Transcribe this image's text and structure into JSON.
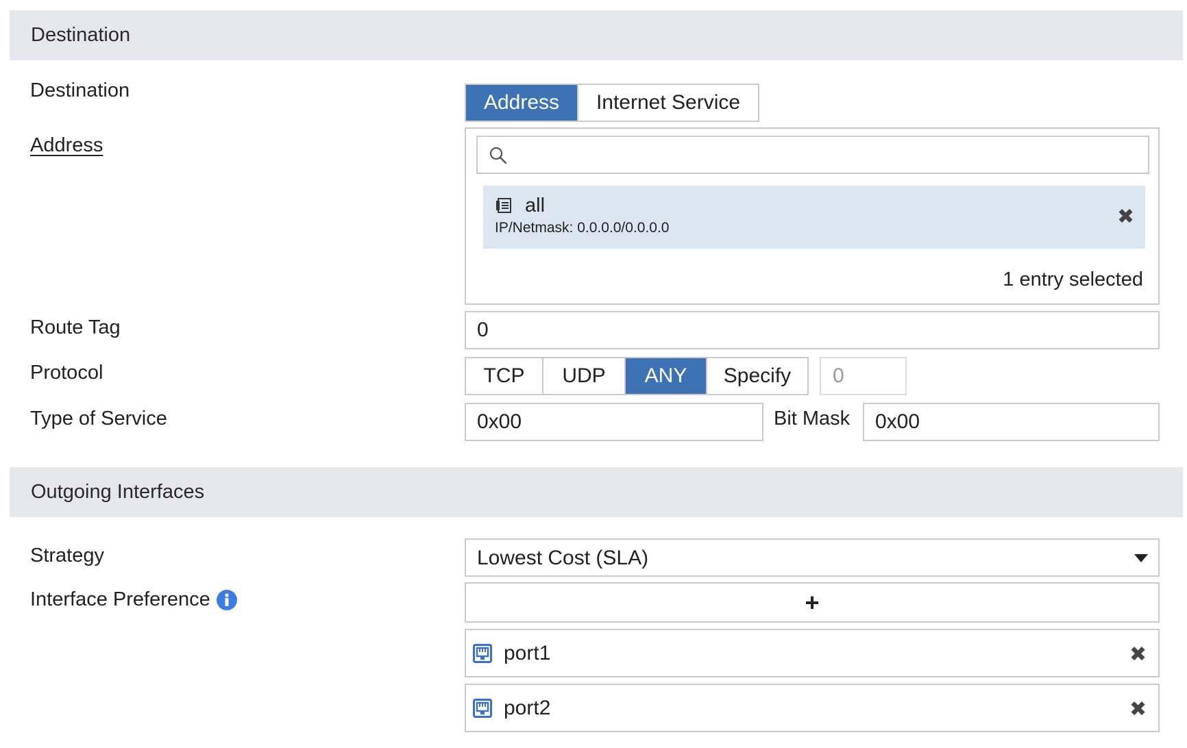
{
  "sections": {
    "destination": "Destination",
    "outgoing": "Outgoing Interfaces"
  },
  "destination": {
    "label": "Destination",
    "options": [
      "Address",
      "Internet Service"
    ],
    "selected": "Address"
  },
  "address": {
    "label": "Address",
    "search_placeholder": "",
    "entry_name": "all",
    "entry_detail": "IP/Netmask: 0.0.0.0/0.0.0.0",
    "summary": "1 entry selected"
  },
  "route_tag": {
    "label": "Route Tag",
    "value": "0"
  },
  "protocol": {
    "label": "Protocol",
    "options": [
      "TCP",
      "UDP",
      "ANY",
      "Specify"
    ],
    "selected": "ANY",
    "specify_value": "0"
  },
  "tos": {
    "label": "Type of Service",
    "value": "0x00",
    "bitmask_label": "Bit Mask",
    "bitmask_value": "0x00"
  },
  "strategy": {
    "label": "Strategy",
    "value": "Lowest Cost (SLA)"
  },
  "interface_pref": {
    "label": "Interface Preference",
    "add_symbol": "+",
    "items": [
      "port1",
      "port2"
    ]
  },
  "colors": {
    "accent": "#3d73b4",
    "section_bg": "#e6e7ea",
    "entry_bg": "#dce6f1",
    "info_icon": "#3d7ce0",
    "port_icon": "#3a6fd8"
  },
  "icons": {
    "search": "search-icon",
    "address": "address-object-icon",
    "remove": "close-icon",
    "info": "info-icon",
    "dropdown": "caret-down-icon",
    "add": "plus-icon",
    "port": "ethernet-port-icon"
  }
}
